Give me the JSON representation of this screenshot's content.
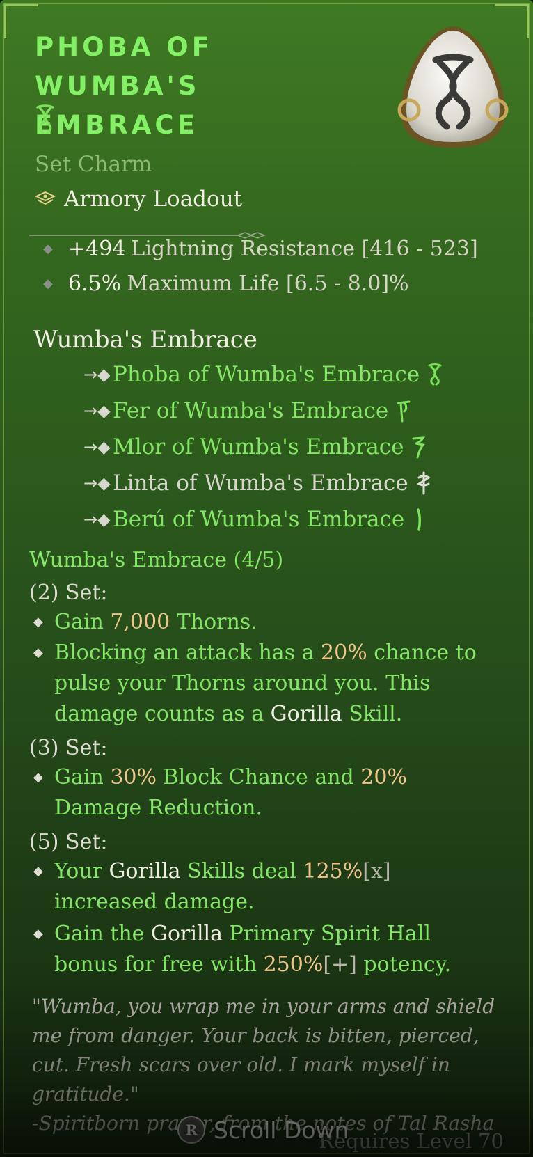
{
  "item": {
    "title_line1": "Phoba of",
    "title_line2": "Wumba's Embrace",
    "type": "Set Charm",
    "slot": "Armory Loadout"
  },
  "affixes": [
    {
      "value": "+494",
      "text": "Lightning Resistance [416 - 523]"
    },
    {
      "value": "6.5%",
      "text": "Maximum Life [6.5 - 8.0]%"
    }
  ],
  "set": {
    "name": "Wumba's Embrace",
    "pieces": [
      {
        "name": "Phoba of Wumba's Embrace",
        "owned": true,
        "rune": "phoba-rune-icon"
      },
      {
        "name": "Fer of Wumba's Embrace",
        "owned": true,
        "rune": "fer-rune-icon"
      },
      {
        "name": "Mlor of Wumba's Embrace",
        "owned": true,
        "rune": "mlor-rune-icon"
      },
      {
        "name": "Linta of Wumba's Embrace",
        "owned": false,
        "rune": "linta-rune-icon"
      },
      {
        "name": "Berú of Wumba's Embrace",
        "owned": true,
        "rune": "beru-rune-icon"
      }
    ],
    "progress_label": "Wumba's Embrace (4/5)"
  },
  "bonuses": {
    "tier2": {
      "label": "(2) Set:",
      "b1": {
        "t1": "Gain ",
        "v1": "7,000",
        "t2": " Thorns."
      },
      "b2": {
        "t1": "Blocking an attack has a ",
        "v1": "20%",
        "t2": " chance to pulse your Thorns around you. This damage counts as a ",
        "w1": "Gorilla",
        "t3": " Skill."
      }
    },
    "tier3": {
      "label": "(3) Set:",
      "b1": {
        "t1": "Gain ",
        "v1": "30%",
        "t2": " Block Chance and ",
        "v2": "20%",
        "t3": " Damage Reduction."
      }
    },
    "tier5": {
      "label": "(5) Set:",
      "b1": {
        "t1": "Your ",
        "w1": "Gorilla",
        "t2": " Skills deal ",
        "v1": "125%",
        "g1": "[x]",
        "t3": " increased damage."
      },
      "b2": {
        "t1": "Gain the ",
        "w1": "Gorilla",
        "t2": " Primary Spirit Hall bonus for free with ",
        "v1": "250%",
        "g1": "[+]",
        "t3": " potency."
      }
    }
  },
  "flavor": {
    "quote": "\"Wumba, you wrap me in your arms and shield me from danger. Your back is bitten, pierced, cut. Fresh scars over old. I mark myself in gratitude.\"",
    "attribution": "-Spiritborn prayer, from the notes of Tal Rasha"
  },
  "requires": "Requires Level 70",
  "footer": {
    "button_glyph": "R",
    "scroll_label": "Scroll Down"
  },
  "colors": {
    "title_green": "#84f065",
    "set_green": "#84e665",
    "value_orange": "#f1c58a",
    "panel_green": "#356a1f"
  }
}
